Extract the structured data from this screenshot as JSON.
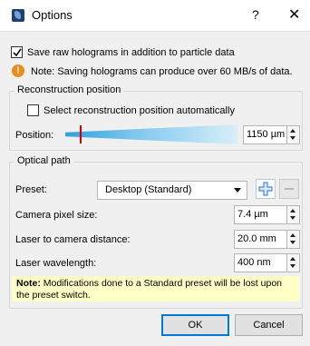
{
  "window": {
    "title": "Options",
    "help_label": "?",
    "close_label": "✕"
  },
  "raw_holograms": {
    "label": "Save raw holograms in addition to particle data",
    "checked": true
  },
  "warning_note": "Note: Saving holograms can produce over 60 MB/s of data.",
  "reconstruction": {
    "group_title": "Reconstruction position",
    "auto_label": "Select reconstruction position automatically",
    "auto_checked": false,
    "position_label": "Position:",
    "position_value": "1150 µm"
  },
  "optical_path": {
    "group_title": "Optical path",
    "preset_label": "Preset:",
    "preset_value": "Desktop (Standard)",
    "camera_pixel_label": "Camera pixel size:",
    "camera_pixel_value": "7.4 µm",
    "laser_distance_label": "Laser to camera distance:",
    "laser_distance_value": "20.0 mm",
    "wavelength_label": "Laser wavelength:",
    "wavelength_value": "400 nm"
  },
  "modification_note": {
    "bold": "Note:",
    "text": " Modifications done to a Standard preset will be lost upon the preset switch."
  },
  "buttons": {
    "ok": "OK",
    "cancel": "Cancel"
  },
  "colors": {
    "accent": "#0078d7",
    "warning": "#f08a1b",
    "note_bg": "#ffffc8",
    "marker": "#d40000"
  },
  "icons": [
    "app-icon",
    "help-icon",
    "close-icon",
    "warning-icon",
    "plus-icon",
    "minus-icon",
    "chevron-down-icon"
  ]
}
